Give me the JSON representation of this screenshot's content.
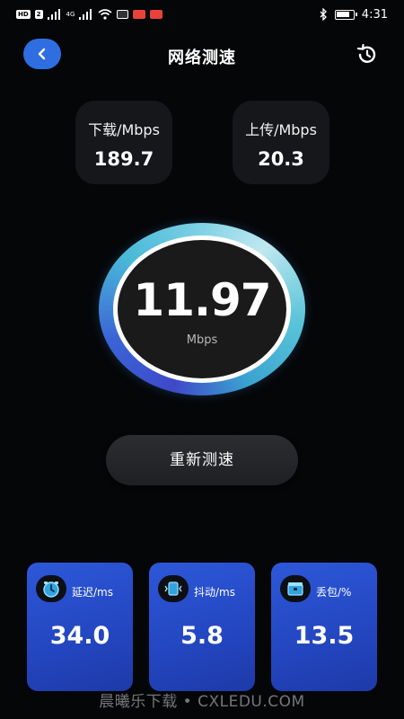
{
  "status_bar": {
    "time": "4:31",
    "left_chip_1": "HD",
    "left_chip_2": "2",
    "signal_1": "x",
    "signal_2": "4G"
  },
  "header": {
    "title": "网络测速"
  },
  "download": {
    "label": "下载/Mbps",
    "value": "189.7"
  },
  "upload": {
    "label": "上传/Mbps",
    "value": "20.3"
  },
  "gauge": {
    "value": "11.97",
    "unit": "Mbps"
  },
  "retest_button": {
    "label": "重新测速"
  },
  "metrics": [
    {
      "label": "延迟/ms",
      "value": "34.0",
      "icon": "clock-icon"
    },
    {
      "label": "抖动/ms",
      "value": "5.8",
      "icon": "jitter-icon"
    },
    {
      "label": "丢包/%",
      "value": "13.5",
      "icon": "packet-icon"
    }
  ],
  "watermark": {
    "text": "晨曦乐下载 • CXLEDU.COM"
  },
  "colors": {
    "accent": "#2f6ee0",
    "card_blue": "#2447c2",
    "background": "#050608"
  }
}
